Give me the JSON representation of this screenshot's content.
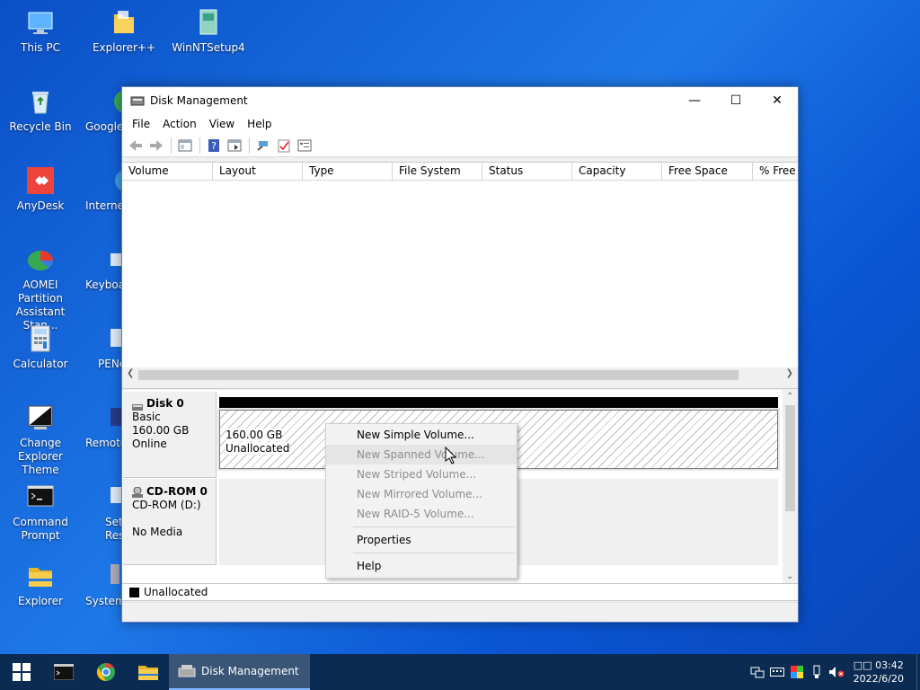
{
  "desktop": {
    "icons": [
      {
        "label": "This PC"
      },
      {
        "label": "Explorer++"
      },
      {
        "label": "WinNTSetup4"
      },
      {
        "label": "Recycle Bin"
      },
      {
        "label": "Google"
      },
      {
        "label": "AnyDesk"
      },
      {
        "label": "Internet"
      },
      {
        "label": "AOMEI Partition Assistant Stan..."
      },
      {
        "label": "Keyboa"
      },
      {
        "label": "Calculator"
      },
      {
        "label": "PENe"
      },
      {
        "label": "Change Explorer Theme"
      },
      {
        "label": "Remote"
      },
      {
        "label": "Command Prompt"
      },
      {
        "label": "Set Reso"
      },
      {
        "label": "Explorer"
      },
      {
        "label": "System"
      }
    ]
  },
  "window": {
    "title": "Disk Management",
    "controls": {
      "minimize": "—",
      "maximize": "☐",
      "close": "✕"
    },
    "menu": [
      "File",
      "Action",
      "View",
      "Help"
    ],
    "columns": [
      "Volume",
      "Layout",
      "Type",
      "File System",
      "Status",
      "Capacity",
      "Free Space",
      "% Free"
    ],
    "disks": [
      {
        "name": "Disk 0",
        "type": "Basic",
        "size": "160.00 GB",
        "state": "Online",
        "partition": {
          "size": "160.00 GB",
          "status": "Unallocated"
        }
      },
      {
        "name": "CD-ROM 0",
        "type": "CD-ROM (D:)",
        "state": "No Media"
      }
    ],
    "legend": "Unallocated"
  },
  "context_menu": {
    "items": [
      {
        "label": "New Simple Volume...",
        "enabled": true
      },
      {
        "label": "New Spanned Volume...",
        "enabled": false
      },
      {
        "label": "New Striped Volume...",
        "enabled": false
      },
      {
        "label": "New Mirrored Volume...",
        "enabled": false
      },
      {
        "label": "New RAID-5 Volume...",
        "enabled": false
      },
      {
        "label": "Properties",
        "enabled": true
      },
      {
        "label": "Help",
        "enabled": true
      }
    ]
  },
  "taskbar": {
    "active_task": "Disk Management",
    "clock_time": "03:42",
    "clock_prefix": "□□",
    "clock_date": "2022/6/20"
  },
  "colors": {
    "desktop": "#1565d8",
    "taskbar": "#0c2b52",
    "unallocated": "#000000"
  }
}
